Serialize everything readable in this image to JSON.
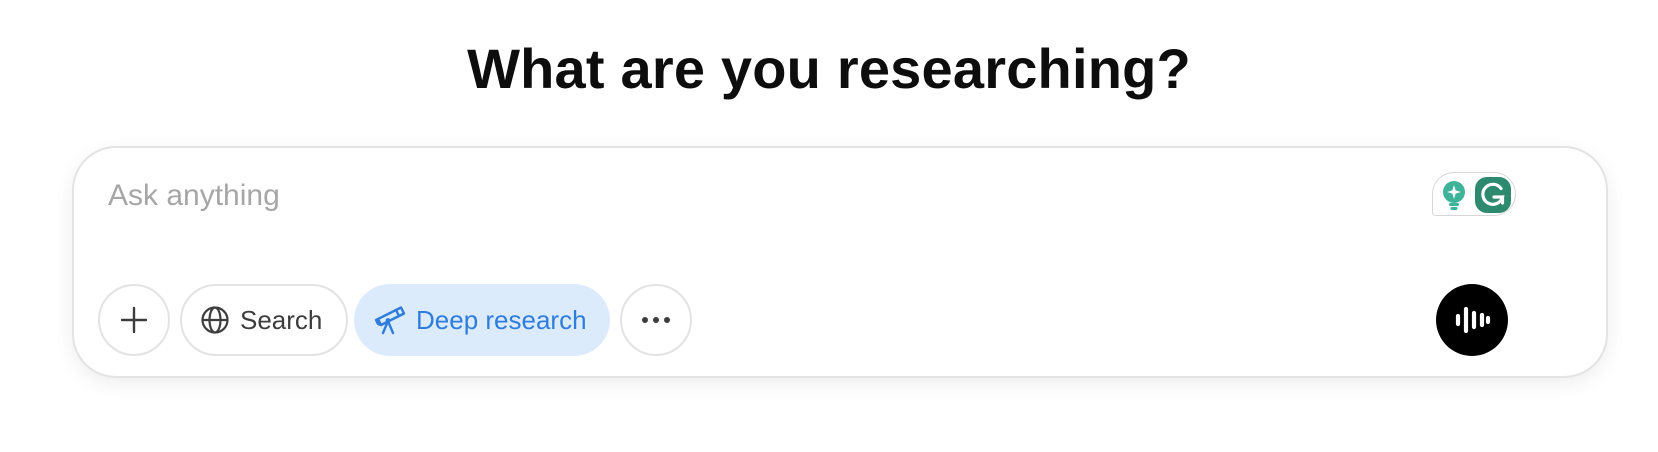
{
  "heading": "What are you researching?",
  "composer": {
    "placeholder": "Ask anything",
    "value": ""
  },
  "toolbar": {
    "add_icon": "plus-icon",
    "search_label": "Search",
    "search_icon": "globe-icon",
    "deep_research_label": "Deep research",
    "deep_research_icon": "telescope-icon",
    "deep_research_active": true,
    "more_icon": "ellipsis-icon",
    "voice_icon": "voice-waveform-icon"
  },
  "extensions": {
    "icons": [
      "lightbulb-icon",
      "grammarly-icon"
    ]
  },
  "colors": {
    "accent": "#2f7ddb",
    "accent_bg": "#dcebfc",
    "voice_button": "#000000",
    "grammarly": "#2e8a6e",
    "bulb": "#3fb39a"
  }
}
